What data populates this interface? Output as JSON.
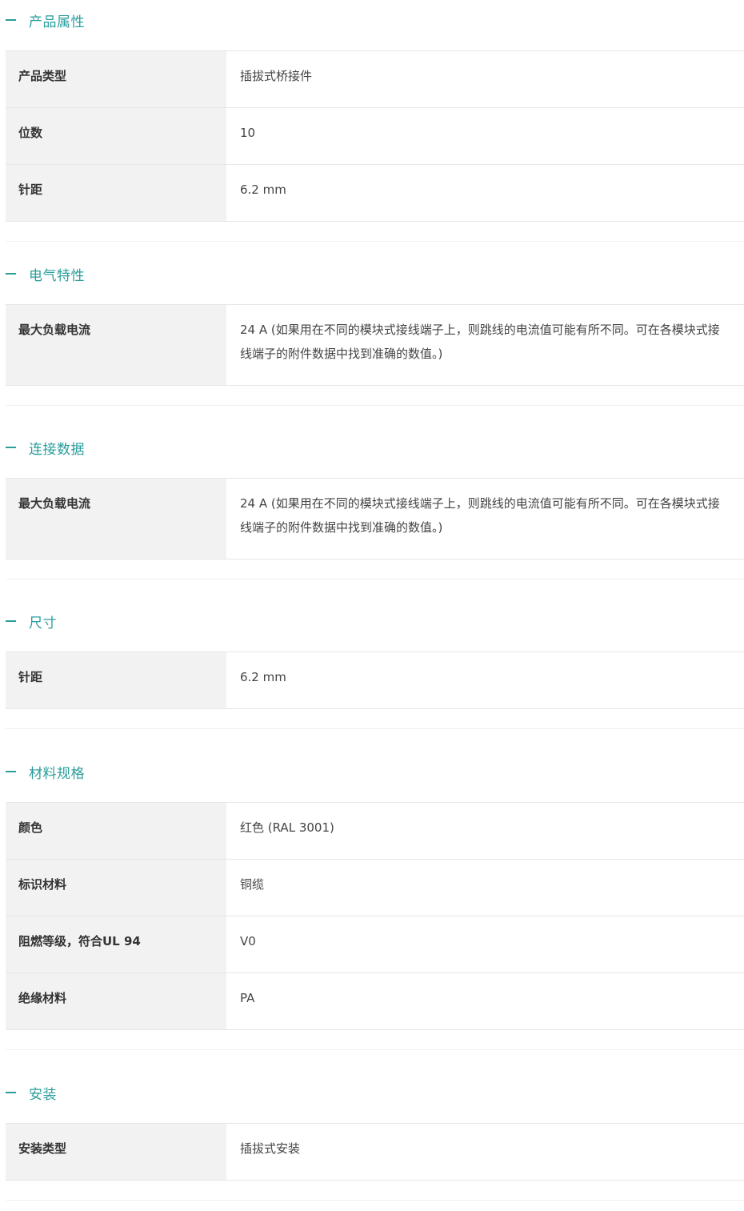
{
  "sections": [
    {
      "title": "产品属性",
      "rows": [
        {
          "label": "产品类型",
          "value": "插拔式桥接件"
        },
        {
          "label": "位数",
          "value": "10"
        },
        {
          "label": "针距",
          "value": "6.2 mm"
        }
      ]
    },
    {
      "title": "电气特性",
      "rows": [
        {
          "label": "最大负载电流",
          "value": "24 A (如果用在不同的模块式接线端子上，则跳线的电流值可能有所不同。可在各模块式接线端子的附件数据中找到准确的数值。)"
        }
      ]
    },
    {
      "title": "连接数据",
      "rows": [
        {
          "label": "最大负载电流",
          "value": "24 A (如果用在不同的模块式接线端子上，则跳线的电流值可能有所不同。可在各模块式接线端子的附件数据中找到准确的数值。)"
        }
      ]
    },
    {
      "title": "尺寸",
      "rows": [
        {
          "label": "针距",
          "value": "6.2 mm"
        }
      ]
    },
    {
      "title": "材料规格",
      "rows": [
        {
          "label": "颜色",
          "value": "红色 (RAL 3001)"
        },
        {
          "label": "标识材料",
          "value": "铜缆"
        },
        {
          "label": "阻燃等级，符合UL 94",
          "value": "V0"
        },
        {
          "label": "绝缘材料",
          "value": "PA"
        }
      ]
    },
    {
      "title": "安装",
      "rows": [
        {
          "label": "安装类型",
          "value": "插拔式安装"
        }
      ]
    }
  ],
  "colors": {
    "accent": "#2a9d9c",
    "label_bg": "#f2f2f2",
    "border": "#e6e6e6"
  },
  "icons": {
    "section_toggle": "collapse-minus-icon"
  }
}
